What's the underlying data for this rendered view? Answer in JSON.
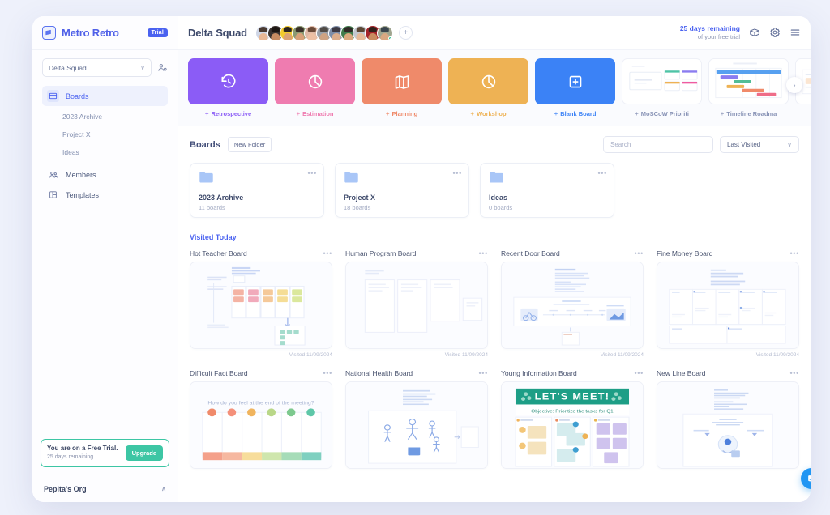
{
  "brand": {
    "name": "Metro Retro",
    "badge": "Trial",
    "logo_icon": "metro-retro-logo-icon"
  },
  "sidebar": {
    "squad_select": {
      "value": "Delta Squad",
      "chevron": "∨"
    },
    "add_member_icon": "add-member-icon",
    "nav": [
      {
        "label": "Boards",
        "icon": "boards-icon",
        "active": true
      },
      {
        "label": "Members",
        "icon": "members-icon",
        "active": false
      },
      {
        "label": "Templates",
        "icon": "templates-icon",
        "active": false
      }
    ],
    "sub_items": [
      {
        "label": "2023 Archive"
      },
      {
        "label": "Project X"
      },
      {
        "label": "Ideas"
      }
    ],
    "trial_box": {
      "title": "You are on a Free Trial.",
      "subtitle": "25 days remaining.",
      "button": "Upgrade"
    },
    "org": {
      "label": "Pepita's Org",
      "chevron": "∧"
    }
  },
  "topbar": {
    "title": "Delta Squad",
    "avatar_count": 11,
    "add_avatar_label": "+",
    "trial": {
      "main": "25 days remaining",
      "sub": "of your free trial"
    },
    "icons": [
      {
        "name": "gift-box-icon"
      },
      {
        "name": "gear-icon"
      },
      {
        "name": "hamburger-menu-icon"
      }
    ]
  },
  "templates": {
    "next_arrow": "›",
    "plus_end": "+",
    "items": [
      {
        "label": "Retrospective",
        "plus": "+",
        "color": "#8b5cf6",
        "icon": "clock-rewind-icon",
        "kind": "solid"
      },
      {
        "label": "Estimation",
        "plus": "+",
        "color": "#ef7cb0",
        "icon": "pie-chart-icon",
        "kind": "solid"
      },
      {
        "label": "Planning",
        "plus": "+",
        "color": "#ef8a6a",
        "icon": "columns-icon",
        "kind": "solid"
      },
      {
        "label": "Workshop",
        "plus": "+",
        "color": "#eeb254",
        "icon": "pie-chart-icon",
        "kind": "solid"
      },
      {
        "label": "Blank Board",
        "plus": "+",
        "color": "#3b82f6",
        "icon": "plus-square-icon",
        "kind": "solid"
      },
      {
        "label": "MoSCoW Prioriti",
        "plus": "+",
        "color": "#8792b5",
        "icon": "moscow-preview-icon",
        "kind": "preview-moscow"
      },
      {
        "label": "Timeline Roadma",
        "plus": "+",
        "color": "#8792b5",
        "icon": "timeline-preview-icon",
        "kind": "preview-timeline"
      },
      {
        "label": "",
        "plus": "",
        "color": "#8792b5",
        "icon": "partial-preview-icon",
        "kind": "preview-partial"
      }
    ]
  },
  "boards_header": {
    "title": "Boards",
    "new_folder": "New Folder",
    "search": {
      "placeholder": "Search",
      "value": ""
    },
    "sort": {
      "value": "Last Visited",
      "chevron": "∨"
    }
  },
  "folders": [
    {
      "name": "2023 Archive",
      "count": "11 boards",
      "dots": "•••",
      "icon": "folder-icon"
    },
    {
      "name": "Project X",
      "count": "18 boards",
      "dots": "•••",
      "icon": "folder-icon"
    },
    {
      "name": "Ideas",
      "count": "0 boards",
      "dots": "•••",
      "icon": "folder-icon"
    }
  ],
  "visited_section": {
    "title": "Visited Today"
  },
  "boards": [
    {
      "name": "Hot Teacher Board",
      "visited": "Visited 11/09/2024",
      "dots": "•••",
      "thumb": "kanban-sticky"
    },
    {
      "name": "Human Program Board",
      "visited": "Visited 11/09/2024",
      "dots": "•••",
      "thumb": "wireframe-columns"
    },
    {
      "name": "Recent Door Board",
      "visited": "Visited 11/09/2024",
      "dots": "•••",
      "thumb": "journey-illustration"
    },
    {
      "name": "Fine Money Board",
      "visited": "Visited 11/09/2024",
      "dots": "•••",
      "thumb": "grid-table"
    },
    {
      "name": "Difficult Fact Board",
      "visited": "",
      "dots": "•••",
      "thumb": "mood-meter",
      "thumb_title": "How do you feel at the end of the meeting?"
    },
    {
      "name": "National Health Board",
      "visited": "",
      "dots": "•••",
      "thumb": "people-illustration"
    },
    {
      "name": "Young Information Board",
      "visited": "",
      "dots": "•••",
      "thumb": "lets-meet",
      "thumb_title": "LET'S MEET!",
      "thumb_subtitle": "Objective: Prioritize the tasks for Q1"
    },
    {
      "name": "New Line Board",
      "visited": "",
      "dots": "•••",
      "thumb": "diagram-center"
    }
  ],
  "chat_widget": {
    "icon": "chat-bubble-icon",
    "color": "#2196f3"
  },
  "colors": {
    "accent": "#4a62f0",
    "page_bg": "#eef1fb",
    "trial_green": "#3dc6a4"
  }
}
